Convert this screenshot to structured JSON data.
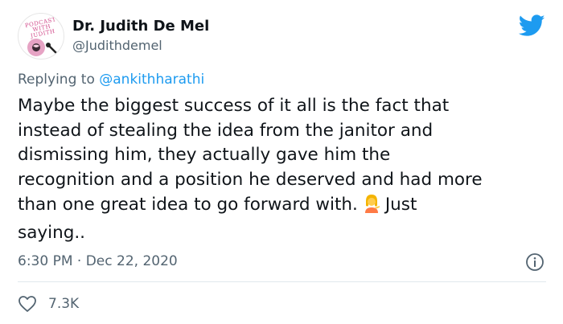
{
  "author": {
    "name": "Dr. Judith De Mel",
    "handle": "@Judithdemel",
    "avatar_text": "PODCAST WITH JUDITH"
  },
  "reply": {
    "prefix": "Replying to",
    "handle": "@ankithharathi"
  },
  "tweet": {
    "lines": [
      "Maybe the biggest success of it all is the fact that",
      "instead of stealing the idea from the janitor and",
      "dismissing him, they actually gave him the",
      "recognition and a position he deserved and had more",
      "than one great idea to go forward with.",
      "saying.."
    ],
    "after_emoji": "Just",
    "emoji": "person-tipping-hand"
  },
  "meta": {
    "time": "6:30 PM",
    "separator": "·",
    "date": "Dec 22, 2020"
  },
  "actions": {
    "likes": "7.3K"
  },
  "icons": {
    "bird": "twitter-bird-icon",
    "info": "info-icon",
    "like": "heart-icon"
  },
  "colors": {
    "accent": "#1d9bf0",
    "text": "#0f1419",
    "muted": "#536471"
  }
}
